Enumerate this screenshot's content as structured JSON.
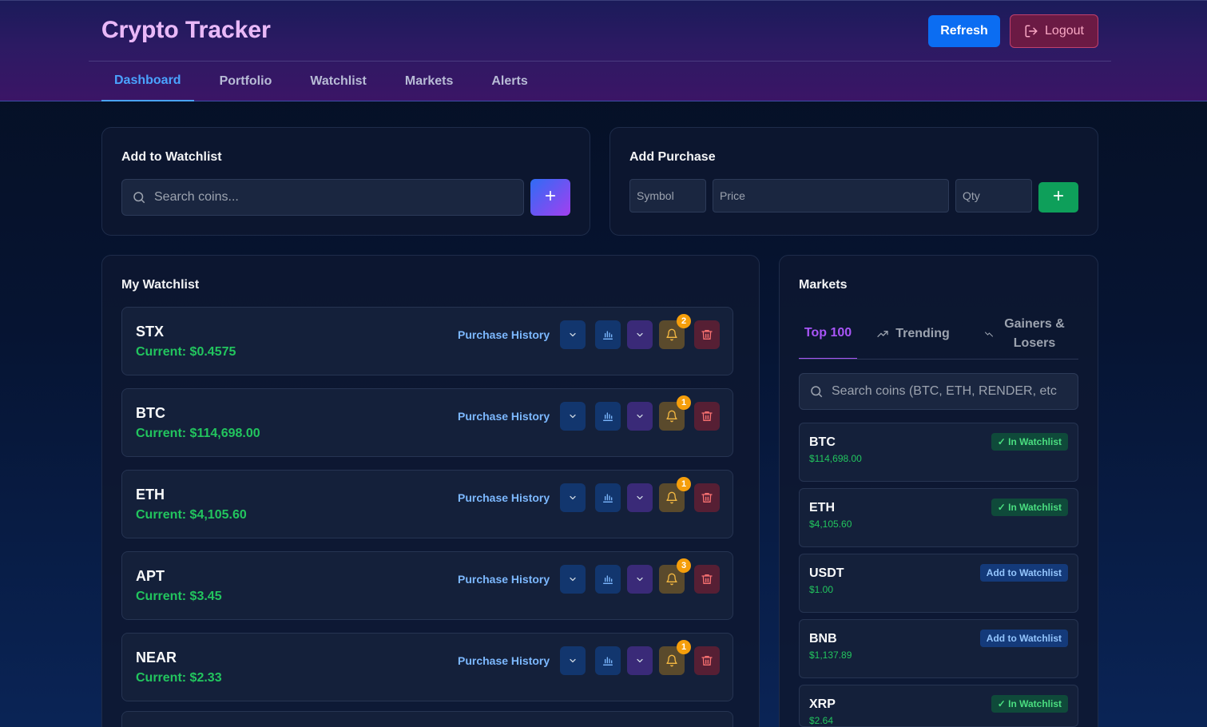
{
  "app": {
    "title": "Crypto Tracker"
  },
  "header": {
    "refresh_label": "Refresh",
    "logout_label": "Logout"
  },
  "nav": {
    "tabs": [
      {
        "label": "Dashboard",
        "active": true
      },
      {
        "label": "Portfolio"
      },
      {
        "label": "Watchlist"
      },
      {
        "label": "Markets"
      },
      {
        "label": "Alerts"
      }
    ]
  },
  "add_watchlist": {
    "title": "Add to Watchlist",
    "search_placeholder": "Search coins..."
  },
  "add_purchase": {
    "title": "Add Purchase",
    "symbol_placeholder": "Symbol",
    "price_placeholder": "Price",
    "qty_placeholder": "Qty"
  },
  "watchlist": {
    "title": "My Watchlist",
    "history_label": "Purchase History",
    "items": [
      {
        "symbol": "STX",
        "price": "Current: $0.4575",
        "alerts": "2"
      },
      {
        "symbol": "BTC",
        "price": "Current: $114,698.00",
        "alerts": "1"
      },
      {
        "symbol": "ETH",
        "price": "Current: $4,105.60",
        "alerts": "1"
      },
      {
        "symbol": "APT",
        "price": "Current: $3.45",
        "alerts": "3"
      },
      {
        "symbol": "NEAR",
        "price": "Current: $2.33",
        "alerts": "1"
      }
    ]
  },
  "markets": {
    "title": "Markets",
    "tabs": [
      {
        "label": "Top 100",
        "active": true
      },
      {
        "label": "Trending"
      },
      {
        "label": "Gainers & Losers"
      }
    ],
    "search_placeholder": "Search coins (BTC, ETH, RENDER, etc",
    "items": [
      {
        "symbol": "BTC",
        "price": "$114,698.00",
        "status": "✓ In Watchlist",
        "in_watchlist": true
      },
      {
        "symbol": "ETH",
        "price": "$4,105.60",
        "status": "✓ In Watchlist",
        "in_watchlist": true
      },
      {
        "symbol": "USDT",
        "price": "$1.00",
        "status": "Add to Watchlist",
        "in_watchlist": false
      },
      {
        "symbol": "BNB",
        "price": "$1,137.89",
        "status": "Add to Watchlist",
        "in_watchlist": false
      },
      {
        "symbol": "XRP",
        "price": "$2.64",
        "status": "✓ In Watchlist",
        "in_watchlist": true
      }
    ]
  },
  "colors": {
    "accent_blue": "#0b6df2",
    "price_green": "#22c55e",
    "active_tab": "#4aa3ff",
    "markets_active": "#a855f7",
    "badge": "#f59e0b"
  }
}
